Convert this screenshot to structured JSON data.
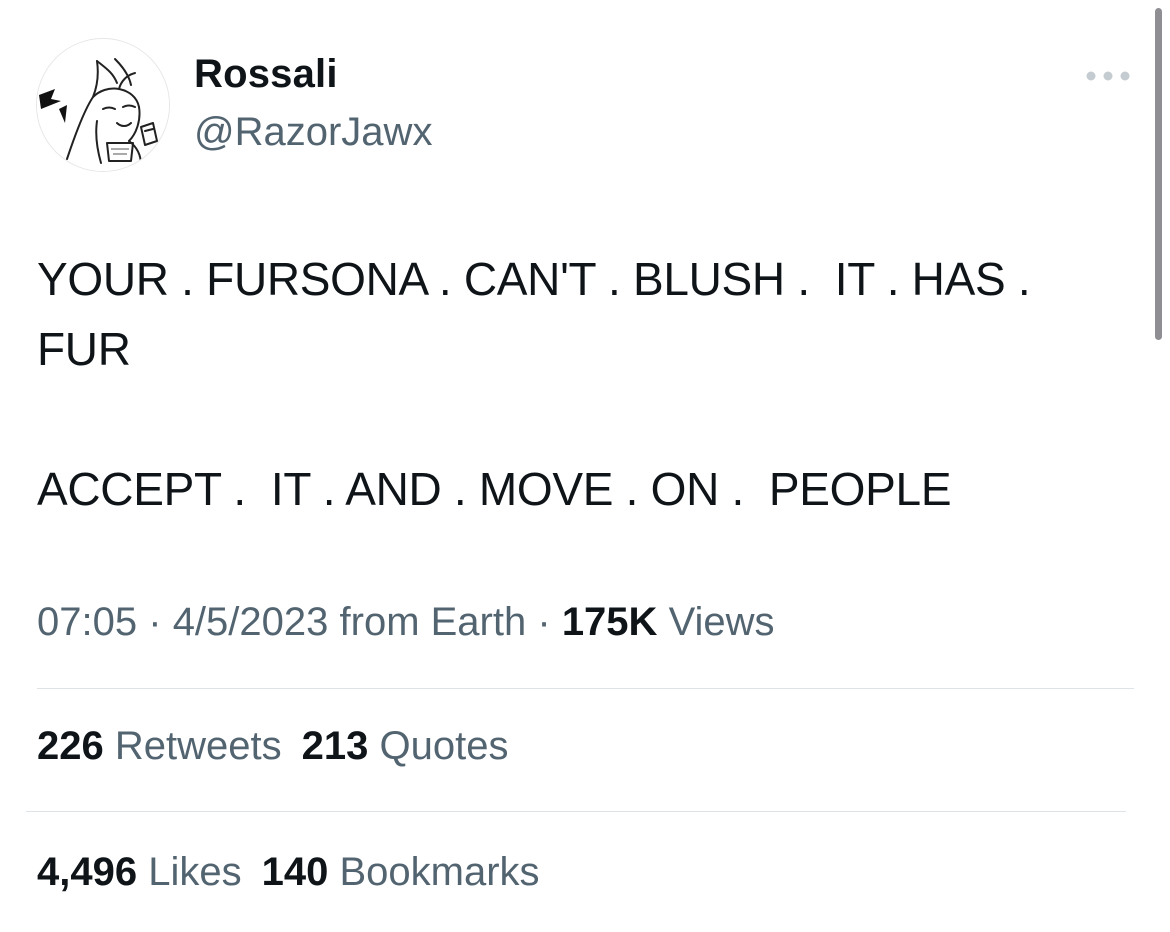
{
  "tweet": {
    "author": {
      "display_name": "Rossali",
      "handle": "@RazorJawx",
      "avatar_icon": "sketch-avatar-icon"
    },
    "more_icon": "more-options-icon",
    "text": "YOUR . FURSONA . CAN'T . BLUSH .  IT . HAS .\nFUR\n\nACCEPT .  IT . AND . MOVE . ON .  PEOPLE",
    "meta": {
      "time": "07:05",
      "separator": "·",
      "date": "4/5/2023",
      "source": "from Earth",
      "views_count": "175K",
      "views_label": "Views"
    },
    "stats": {
      "retweets_count": "226",
      "retweets_label": "Retweets",
      "quotes_count": "213",
      "quotes_label": "Quotes",
      "likes_count": "4,496",
      "likes_label": "Likes",
      "bookmarks_count": "140",
      "bookmarks_label": "Bookmarks"
    }
  },
  "colors": {
    "primary_text": "#0f1419",
    "secondary_text": "#536471",
    "divider": "#dfe3e6",
    "scrollbar": "#8e8e93"
  }
}
